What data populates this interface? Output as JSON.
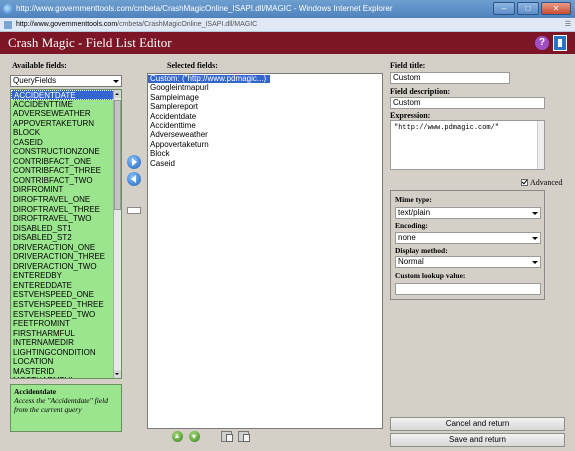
{
  "browser": {
    "title": "http://www.governmenttools.com/cmbeta/CrashMagicOnline_ISAPI.dll/MAGIC - Windows Internet Explorer",
    "address_host": "http://www.governmenttools.com",
    "address_path": "/cmbeta/CrashMagicOnline_ISAPI.dll/MAGIC",
    "address_right": "☰",
    "controls": {
      "minimize": "–",
      "maximize": "□",
      "close": "✕"
    }
  },
  "app": {
    "title": "Crash Magic - Field List Editor",
    "help_icon": "?"
  },
  "available": {
    "label": "Available fields:",
    "group_value": "QueryFields",
    "items": [
      "ACCIDENTDATE",
      "ACCIDENTTIME",
      "ADVERSEWEATHER",
      "APPOVERTAKETURN",
      "BLOCK",
      "CASEID",
      "CONSTRUCTIONZONE",
      "CONTRIBFACT_ONE",
      "CONTRIBFACT_THREE",
      "CONTRIBFACT_TWO",
      "DIRFROMINT",
      "DIROFTRAVEL_ONE",
      "DIROFTRAVEL_THREE",
      "DIROFTRAVEL_TWO",
      "DISABLED_ST1",
      "DISABLED_ST2",
      "DRIVERACTION_ONE",
      "DRIVERACTION_THREE",
      "DRIVERACTION_TWO",
      "ENTEREDBY",
      "ENTEREDDATE",
      "ESTVEHSPEED_ONE",
      "ESTVEHSPEED_THREE",
      "ESTVEHSPEED_TWO",
      "FEETFROMINT",
      "FIRSTHARMFUL",
      "INTERNAMEDIR",
      "LIGHTINGCONDITION",
      "LOCATION",
      "MASTERID",
      "MOSTHARMFUL"
    ],
    "selected_index": 0
  },
  "description": {
    "title": "Accidentdate",
    "text": "Access the \"Accidentdate\" field from the current query"
  },
  "selected": {
    "label": "Selected fields:",
    "items": [
      "Custom: (\"http://www.pdmagic...)",
      "Googleintmapurl",
      "Sampleimage",
      "Samplereport",
      "Accidentdate",
      "Accidenttime",
      "Adverseweather",
      "Appovertaketurn",
      "Block",
      "Caseid"
    ],
    "selected_index": 0
  },
  "field": {
    "title_label": "Field title:",
    "title_value": "Custom",
    "desc_label": "Field description:",
    "desc_value": "Custom",
    "expr_label": "Expression:",
    "expr_value": "\"http://www.pdmagic.com/\""
  },
  "advanced": {
    "label": "Advanced",
    "checked": true,
    "mime_label": "Mime type:",
    "mime_value": "text/plain",
    "encoding_label": "Encoding:",
    "encoding_value": "none",
    "display_label": "Display method:",
    "display_value": "Normal",
    "lookup_label": "Custom lookup value:",
    "lookup_value": ""
  },
  "actions": {
    "cancel": "Cancel and return",
    "save": "Save and return"
  },
  "icons": {
    "move_right": "arrow-right-icon",
    "move_left": "arrow-left-icon",
    "move_up": "arrow-up-icon",
    "move_down": "arrow-down-icon",
    "copy": "copy-icon",
    "paste": "paste-icon"
  },
  "colors": {
    "header": "#7c1525",
    "list_green": "#9be58f",
    "selection": "#3366cc"
  }
}
